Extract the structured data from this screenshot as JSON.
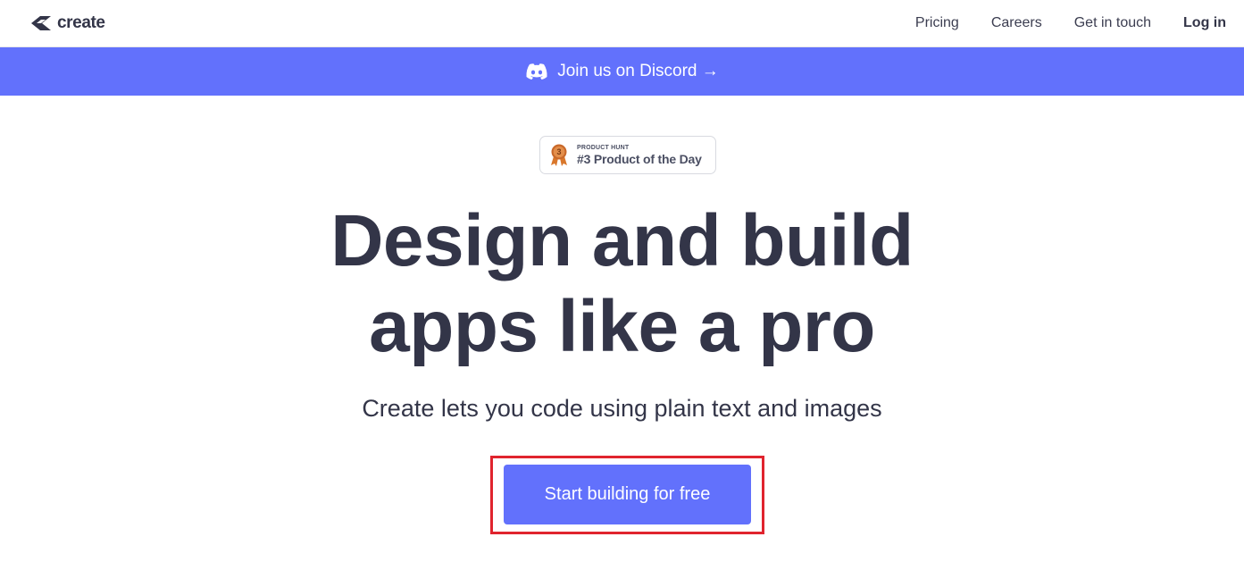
{
  "header": {
    "logo_text": "create",
    "logo_icon": "create-logo-icon",
    "nav": [
      {
        "label": "Pricing"
      },
      {
        "label": "Careers"
      },
      {
        "label": "Get in touch"
      },
      {
        "label": "Log in"
      }
    ]
  },
  "banner": {
    "icon": "discord-icon",
    "text": "Join us on Discord →",
    "background": "#6271fc"
  },
  "badge": {
    "icon": "medal-icon",
    "rank_digit": "3",
    "small_label": "PRODUCT HUNT",
    "main_label": "#3 Product of the Day"
  },
  "hero": {
    "title_line1": "Design and build",
    "title_line2": "apps like a pro",
    "subtitle": "Create lets you code using plain text and images"
  },
  "cta": {
    "label": "Start building for free",
    "color": "#6271fc",
    "highlight_color": "#e0242e"
  }
}
